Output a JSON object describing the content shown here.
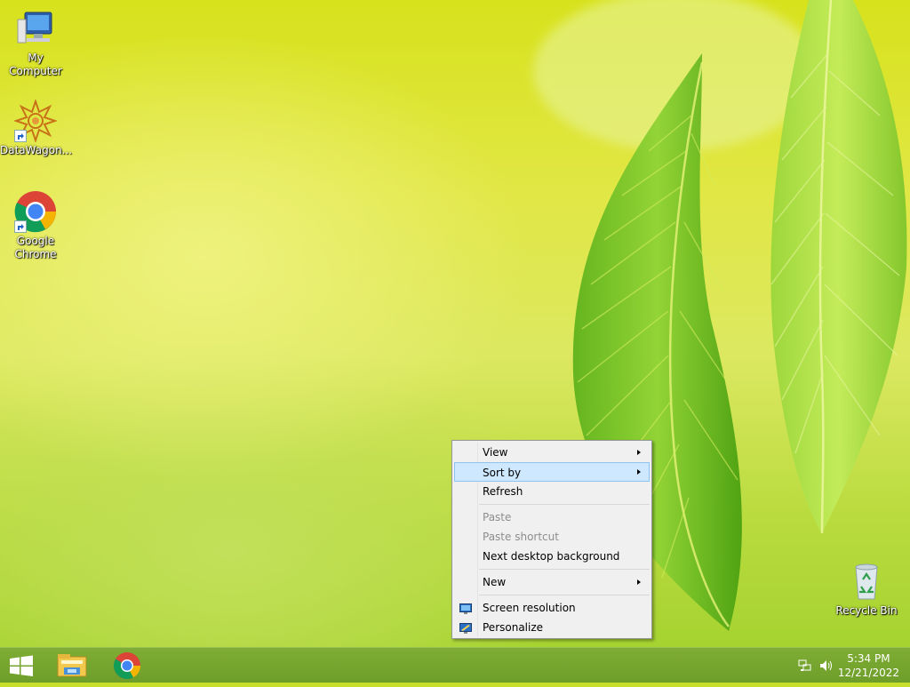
{
  "desktop": {
    "icons": [
      {
        "label": "My Computer"
      },
      {
        "label": "DataWagon..."
      },
      {
        "label": "Google Chrome"
      }
    ],
    "recycle_bin": {
      "label": "Recycle Bin"
    }
  },
  "context_menu": {
    "items": [
      {
        "label": "View",
        "has_submenu": true,
        "enabled": true
      },
      {
        "label": "Sort by",
        "has_submenu": true,
        "enabled": true,
        "highlighted": true
      },
      {
        "label": "Refresh",
        "enabled": true
      },
      {
        "label": "Paste",
        "enabled": false
      },
      {
        "label": "Paste shortcut",
        "enabled": false
      },
      {
        "label": "Next desktop background",
        "enabled": true
      },
      {
        "label": "New",
        "has_submenu": true,
        "enabled": true
      },
      {
        "label": "Screen resolution",
        "enabled": true,
        "icon": "monitor-icon"
      },
      {
        "label": "Personalize",
        "enabled": true,
        "icon": "personalize-icon"
      }
    ]
  },
  "taskbar": {
    "pinned": [
      "start-button",
      "file-explorer-icon",
      "chrome-icon"
    ],
    "clock": {
      "time": "5:34 PM",
      "date": "12/21/2022"
    }
  },
  "colors": {
    "taskbar": "#729f2d",
    "menu_background": "#f0f0f0",
    "menu_highlight": "#cde8ff"
  }
}
